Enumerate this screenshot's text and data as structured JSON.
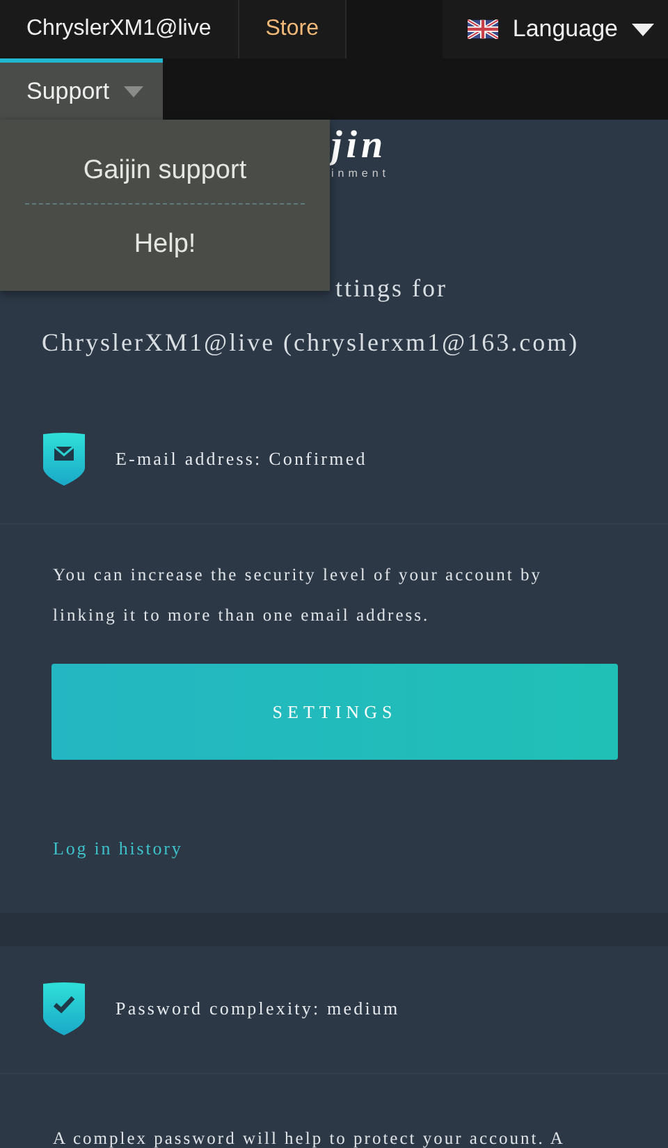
{
  "nav": {
    "tabs": [
      {
        "label": "ChryslerXM1@live",
        "kind": "account",
        "selected": false
      },
      {
        "label": "Store",
        "kind": "store",
        "selected": false
      }
    ],
    "language": {
      "label": "Language"
    },
    "support": {
      "label": "Support",
      "selected": true,
      "expanded": true,
      "items": [
        {
          "label": "Gaijin support"
        },
        {
          "label": "Help!"
        }
      ]
    }
  },
  "logo": {
    "wordmark": "jin",
    "tagline": "inment"
  },
  "heading": "ttings for",
  "account": "ChryslerXM1@live (chryslerxm1@163.com)",
  "sections": [
    {
      "kind": "envelope",
      "title": "E-mail address: Confirmed",
      "text": "You can increase the security level of your account by linking it to more than one email address.",
      "button": "SETTINGS",
      "link": "Log in history"
    },
    {
      "kind": "check",
      "title": "Password complexity: medium",
      "text": "A complex password will help to protect your account. A"
    }
  ]
}
